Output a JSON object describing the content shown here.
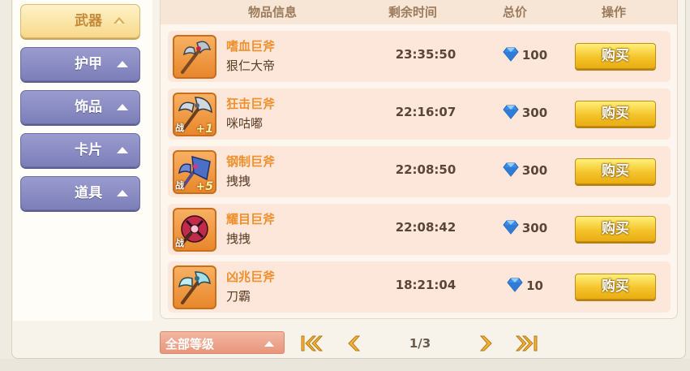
{
  "sidebar": {
    "items": [
      {
        "label": "武器",
        "active": true
      },
      {
        "label": "护甲",
        "active": false
      },
      {
        "label": "饰品",
        "active": false
      },
      {
        "label": "卡片",
        "active": false
      },
      {
        "label": "道具",
        "active": false
      }
    ]
  },
  "table": {
    "headers": {
      "info": "物品信息",
      "time": "剩余时间",
      "price": "总价",
      "action": "操作"
    },
    "rows": [
      {
        "name": "嗜血巨斧",
        "seller": "狠仁大帝",
        "time": "23:35:50",
        "price": "100",
        "buy": "购买",
        "icon": "bloodthirst-axe-icon",
        "badge": "",
        "plus": ""
      },
      {
        "name": "狂击巨斧",
        "seller": "咪咕嘟",
        "time": "22:16:07",
        "price": "300",
        "buy": "购买",
        "icon": "rampage-axe-icon",
        "badge": "战",
        "plus": "+1"
      },
      {
        "name": "钢制巨斧",
        "seller": "拽拽",
        "time": "22:08:50",
        "price": "300",
        "buy": "购买",
        "icon": "steel-axe-icon",
        "badge": "战",
        "plus": "+5"
      },
      {
        "name": "耀目巨斧",
        "seller": "拽拽",
        "time": "22:08:42",
        "price": "300",
        "buy": "购买",
        "icon": "dazzling-axe-icon",
        "badge": "战",
        "plus": ""
      },
      {
        "name": "凶兆巨斧",
        "seller": "刀霸",
        "time": "18:21:04",
        "price": "10",
        "buy": "购买",
        "icon": "omen-axe-icon",
        "badge": "",
        "plus": ""
      }
    ]
  },
  "footer": {
    "level_filter": "全部等级",
    "page": "1/3"
  },
  "colors": {
    "accent": "#f0902c",
    "buy_button": "#f4c42c",
    "sidebar_item": "#8b8dc4",
    "row_bg": "#fde7da"
  }
}
